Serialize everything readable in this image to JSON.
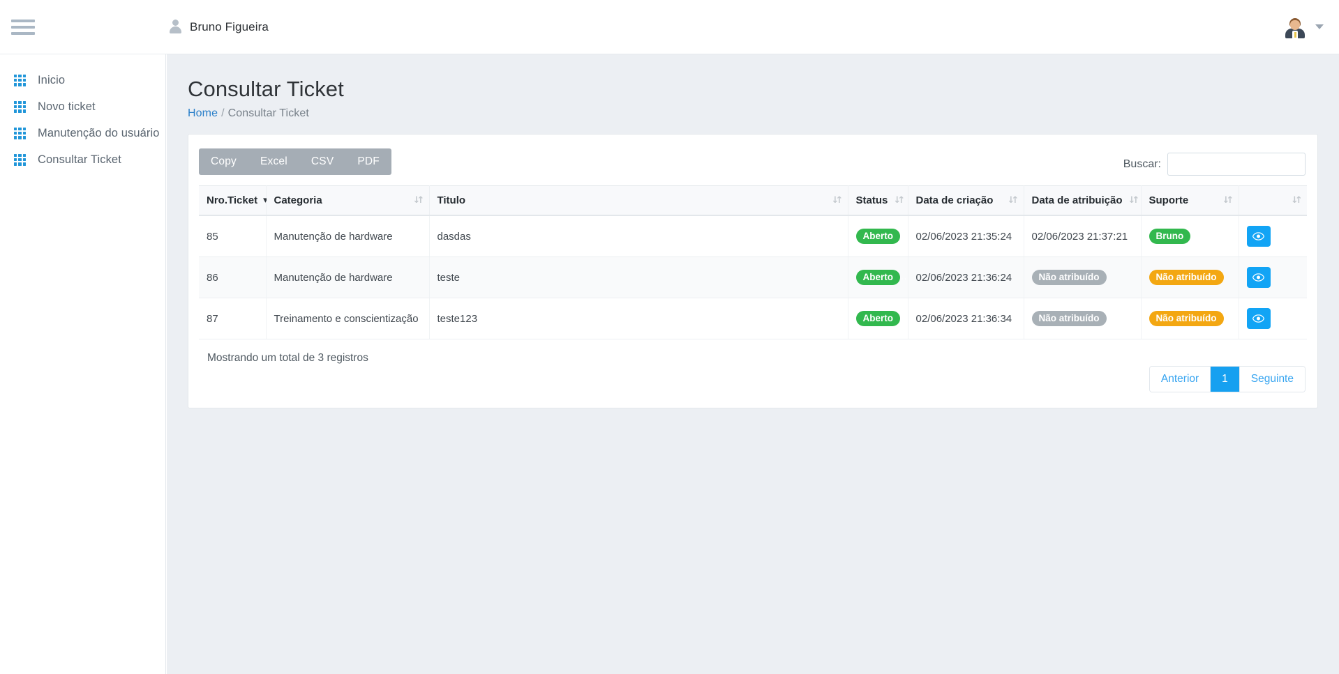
{
  "topbar": {
    "menu_icon": "hamburger-icon",
    "user_icon": "person-icon",
    "user_name": "Bruno Figueira",
    "avatar_icon": "user-avatar",
    "caret_icon": "chevron-down-icon"
  },
  "sidebar": {
    "items": [
      {
        "label": "Inicio",
        "icon": "grid-icon"
      },
      {
        "label": "Novo ticket",
        "icon": "grid-icon"
      },
      {
        "label": "Manutenção do usuário",
        "icon": "grid-icon"
      },
      {
        "label": "Consultar Ticket",
        "icon": "grid-icon"
      }
    ]
  },
  "page": {
    "title": "Consultar Ticket",
    "breadcrumb_home": "Home",
    "breadcrumb_sep": "/",
    "breadcrumb_current": "Consultar Ticket"
  },
  "toolbar": {
    "export_buttons": [
      "Copy",
      "Excel",
      "CSV",
      "PDF"
    ],
    "search_label": "Buscar:",
    "search_value": "",
    "search_placeholder": ""
  },
  "table": {
    "columns": [
      {
        "label": "Nro.Ticket",
        "sorted": true
      },
      {
        "label": "Categoria",
        "sorted": false
      },
      {
        "label": "Titulo",
        "sorted": false
      },
      {
        "label": "Status",
        "sorted": false
      },
      {
        "label": "Data de criação",
        "sorted": false
      },
      {
        "label": "Data de atribuição",
        "sorted": false
      },
      {
        "label": "Suporte",
        "sorted": false
      },
      {
        "label": "",
        "sorted": false
      }
    ],
    "rows": [
      {
        "nro": "85",
        "categoria": "Manutenção de hardware",
        "titulo": "dasdas",
        "status": "Aberto",
        "status_color": "green",
        "data_criacao": "02/06/2023 21:35:24",
        "data_atribuicao": "02/06/2023 21:37:21",
        "data_atribuicao_badge": false,
        "suporte": "Bruno",
        "suporte_color": "green",
        "action_icon": "eye-icon"
      },
      {
        "nro": "86",
        "categoria": "Manutenção de hardware",
        "titulo": "teste",
        "status": "Aberto",
        "status_color": "green",
        "data_criacao": "02/06/2023 21:36:24",
        "data_atribuicao": "Não atribuído",
        "data_atribuicao_badge": true,
        "suporte": "Não atribuído",
        "suporte_color": "orange",
        "action_icon": "eye-icon"
      },
      {
        "nro": "87",
        "categoria": "Treinamento e conscientização",
        "titulo": "teste123",
        "status": "Aberto",
        "status_color": "green",
        "data_criacao": "02/06/2023 21:36:34",
        "data_atribuicao": "Não atribuído",
        "data_atribuicao_badge": true,
        "suporte": "Não atribuído",
        "suporte_color": "orange",
        "action_icon": "eye-icon"
      }
    ]
  },
  "footer": {
    "info": "Mostrando um total de 3 registros",
    "pagination": {
      "previous": "Anterior",
      "pages": [
        "1"
      ],
      "current_page": "1",
      "next": "Seguinte"
    }
  },
  "colors": {
    "accent_blue": "#12a4f5",
    "link_blue": "#2a7fc9",
    "badge_green": "#32b84e",
    "badge_gray": "#a8b0b6",
    "badge_orange": "#f3a712",
    "sidebar_icon_blue": "#2196d9",
    "export_bar_gray": "#a5adb5",
    "content_bg": "#eceff3"
  }
}
